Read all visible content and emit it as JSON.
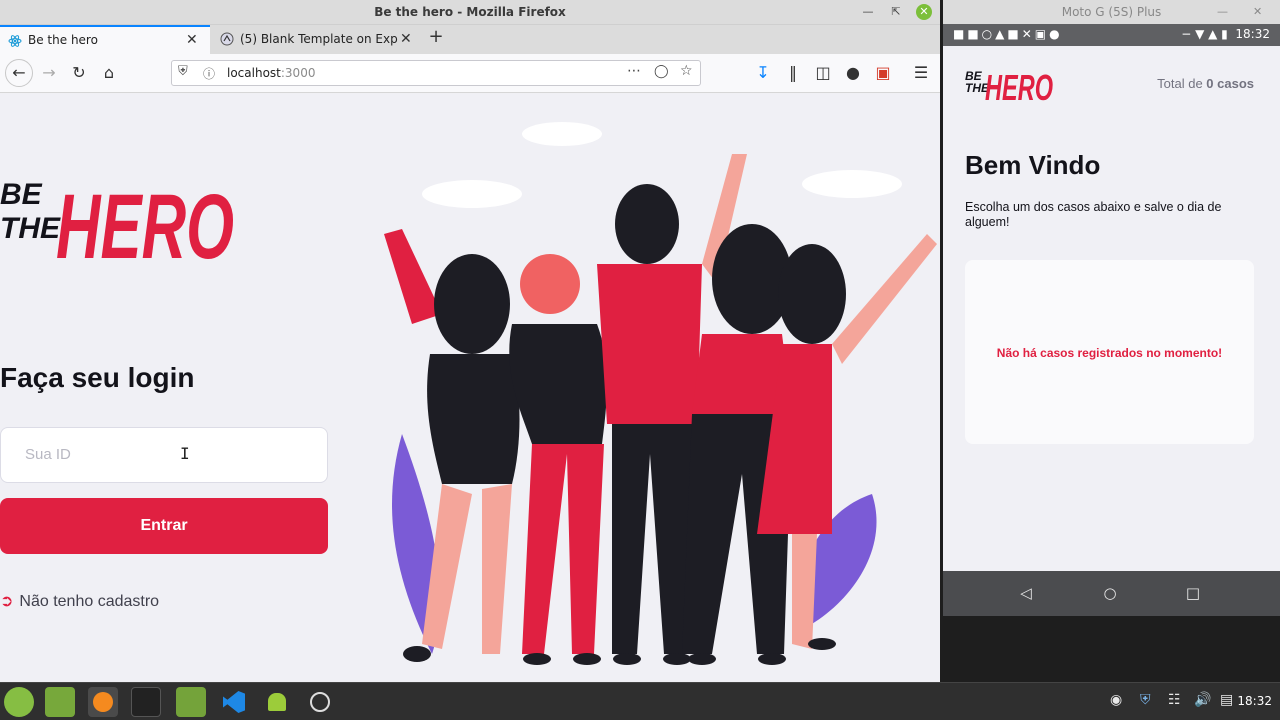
{
  "firefox": {
    "window_title": "Be the hero - Mozilla Firefox",
    "tabs": [
      {
        "label": "Be the hero",
        "active": true
      },
      {
        "label": "(5) Blank Template on Expo",
        "active": false
      }
    ],
    "url_host": "localhost",
    "url_port": ":3000"
  },
  "page": {
    "logo_top": "BE",
    "logo_mid": "THE",
    "logo_word": "HERO",
    "login_title": "Faça seu login",
    "input_placeholder": "Sua ID",
    "login_button": "Entrar",
    "register_link": "Não tenho cadastro"
  },
  "emulator": {
    "window_title": "Moto G (5S) Plus",
    "status_time": "18:32",
    "total_prefix": "Total de ",
    "total_count": "0 casos",
    "welcome": "Bem Vindo",
    "description": "Escolha um dos casos abaixo e salve o dia de alguem!",
    "empty_message": "Não há casos registrados no momento!"
  },
  "taskbar": {
    "clock": "18:32"
  },
  "colors": {
    "brand_red": "#e02041",
    "background": "#f0f0f5",
    "text_dark": "#13131a"
  }
}
